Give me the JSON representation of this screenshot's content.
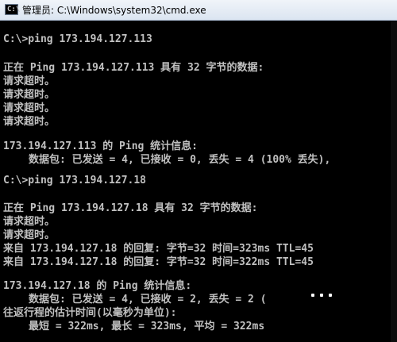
{
  "window": {
    "title": "管理员: C:\\Windows\\system32\\cmd.exe",
    "icon": "cmd-icon"
  },
  "console": {
    "lines": [
      "C:\\>ping 173.194.127.113",
      "正在 Ping 173.194.127.113 具有 32 字节的数据:",
      "请求超时。",
      "请求超时。",
      "请求超时。",
      "请求超时。",
      "173.194.127.113 的 Ping 统计信息:",
      "数据包: 已发送 = 4, 已接收 = 0, 丢失 = 4 (100% 丢失),",
      "C:\\>ping 173.194.127.18",
      "正在 Ping 173.194.127.18 具有 32 字节的数据:",
      "请求超时。",
      "请求超时。",
      "来自 173.194.127.18 的回复: 字节=32 时间=323ms TTL=45",
      "来自 173.194.127.18 的回复: 字节=32 时间=322ms TTL=45",
      "173.194.127.18 的 Ping 统计信息:",
      "数据包: 已发送 = 4, 已接收 = 2, 丢失 = 2 (",
      "往返行程的估计时间(以毫秒为单位):",
      "最短 = 322ms, 最长 = 323ms, 平均 = 322ms"
    ]
  }
}
